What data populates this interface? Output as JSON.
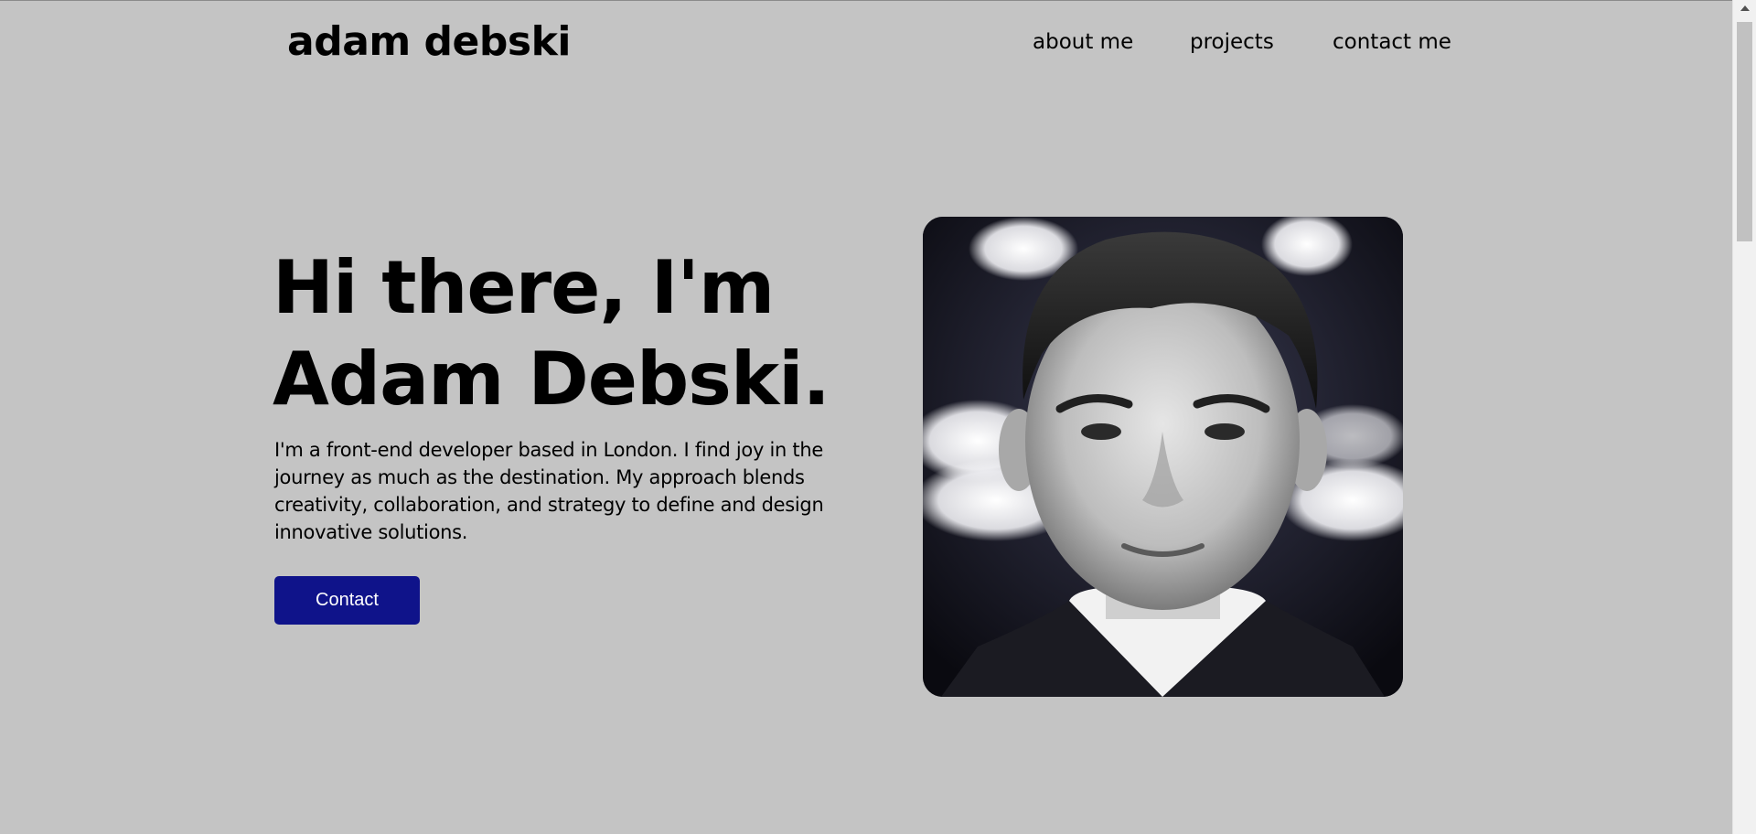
{
  "header": {
    "logo": "adam debski",
    "nav": [
      {
        "label": "about me"
      },
      {
        "label": "projects"
      },
      {
        "label": "contact me"
      }
    ]
  },
  "hero": {
    "title_line1": "Hi there, I'm",
    "title_line2": "Adam Debski.",
    "description": "I'm a front-end developer based in London. I find joy in the journey as much as the destination. My approach blends creativity, collaboration, and strategy to define and design innovative solutions.",
    "contact_label": "Contact",
    "portrait_alt": "Portrait of Adam Debski"
  },
  "colors": {
    "background": "#c4c4c4",
    "button": "#0f138a",
    "button_text": "#ffffff"
  }
}
